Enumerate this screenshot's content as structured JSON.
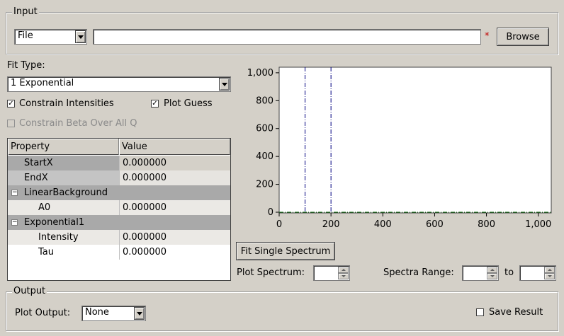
{
  "input": {
    "group_title": "Input",
    "source_type": "File",
    "path_value": "",
    "required_marker": "*",
    "browse_label": "Browse"
  },
  "fit": {
    "fit_type_label": "Fit Type:",
    "fit_type_value": "1 Exponential",
    "constrain_intensities_label": "Constrain Intensities",
    "constrain_intensities_checked": true,
    "plot_guess_label": "Plot Guess",
    "plot_guess_checked": true,
    "constrain_beta_label": "Constrain Beta Over All Q",
    "constrain_beta_checked": false,
    "constrain_beta_enabled": false
  },
  "properties": {
    "header_property": "Property",
    "header_value": "Value",
    "rows": [
      {
        "name": "StartX",
        "value": "0.000000"
      },
      {
        "name": "EndX",
        "value": "0.000000"
      },
      {
        "name": "LinearBackground",
        "value": ""
      },
      {
        "name": "A0",
        "value": "0.000000"
      },
      {
        "name": "Exponential1",
        "value": ""
      },
      {
        "name": "Intensity",
        "value": "0.000000"
      },
      {
        "name": "Tau",
        "value": "0.000000"
      }
    ]
  },
  "chart_data": {
    "type": "line",
    "xlim": [
      0,
      1050
    ],
    "ylim": [
      -5,
      1040
    ],
    "x_ticks": [
      "0",
      "200",
      "400",
      "600",
      "800",
      "1,000"
    ],
    "x_tick_values": [
      0,
      200,
      400,
      600,
      800,
      1000
    ],
    "y_ticks": [
      "0",
      "200",
      "400",
      "600",
      "800",
      "1,000"
    ],
    "y_tick_values": [
      0,
      200,
      400,
      600,
      800,
      1000
    ],
    "range_markers_x": [
      100,
      200
    ],
    "baseline_y": 0,
    "marker_color": "#000080",
    "baseline_color": "#006400",
    "series": []
  },
  "actions": {
    "fit_single_label": "Fit Single Spectrum",
    "plot_spectrum_label": "Plot Spectrum:",
    "plot_spectrum_value": "",
    "spectra_range_label": "Spectra Range:",
    "spectra_range_from": "",
    "to_label": "to",
    "spectra_range_to": ""
  },
  "output": {
    "group_title": "Output",
    "plot_output_label": "Plot Output:",
    "plot_output_value": "None",
    "save_result_label": "Save Result",
    "save_result_checked": false
  }
}
